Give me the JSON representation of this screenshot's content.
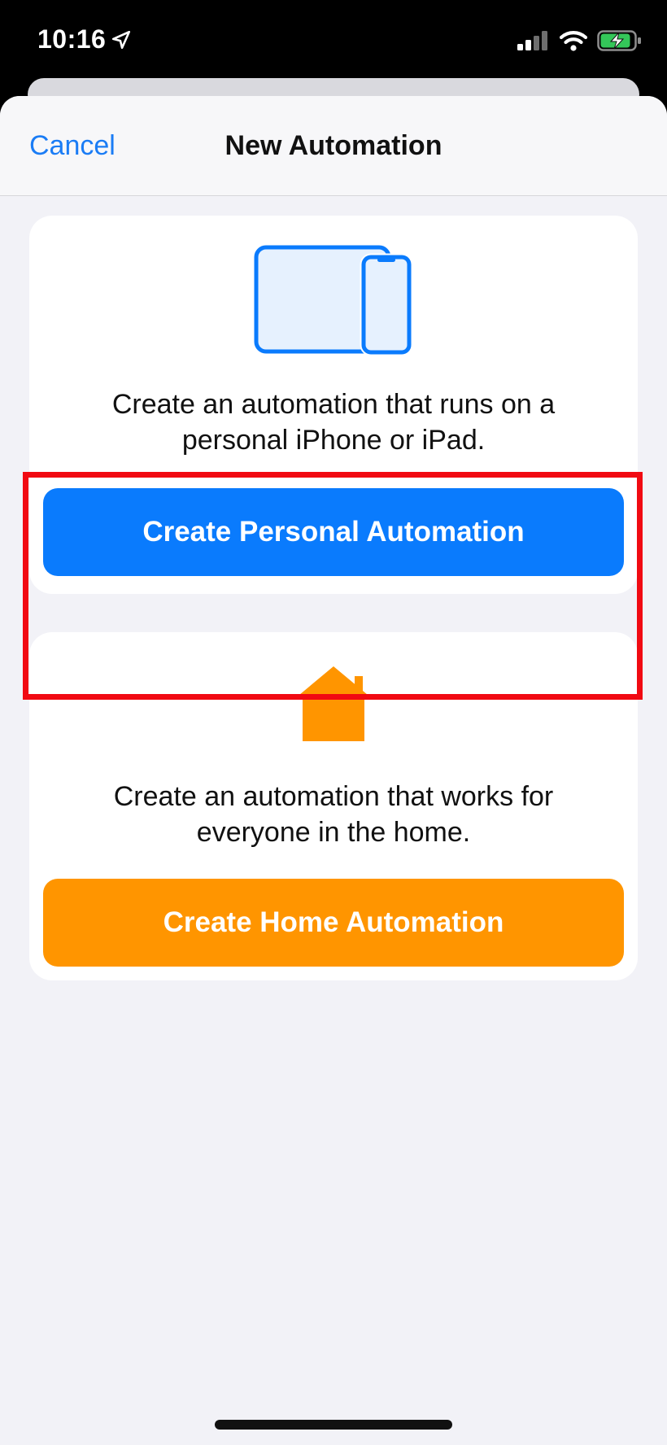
{
  "status_bar": {
    "time": "10:16",
    "location_icon": "location-arrow-icon",
    "signal_icon": "cellular-signal-icon",
    "wifi_icon": "wifi-icon",
    "battery_icon": "battery-charging-icon"
  },
  "nav": {
    "cancel_label": "Cancel",
    "title": "New Automation"
  },
  "personal_card": {
    "icon": "ipad-iphone-icon",
    "description": "Create an automation that runs on a personal iPhone or iPad.",
    "button_label": "Create Personal Automation"
  },
  "home_card": {
    "icon": "house-icon",
    "description": "Create an automation that works for everyone in the home.",
    "button_label": "Create Home Automation"
  },
  "colors": {
    "accent_blue": "#0a7bfd",
    "link_blue": "#1a7cf5",
    "home_orange": "#ff9500",
    "highlight_red": "#f10a12",
    "background": "#f2f2f7",
    "battery_green": "#34c759"
  }
}
